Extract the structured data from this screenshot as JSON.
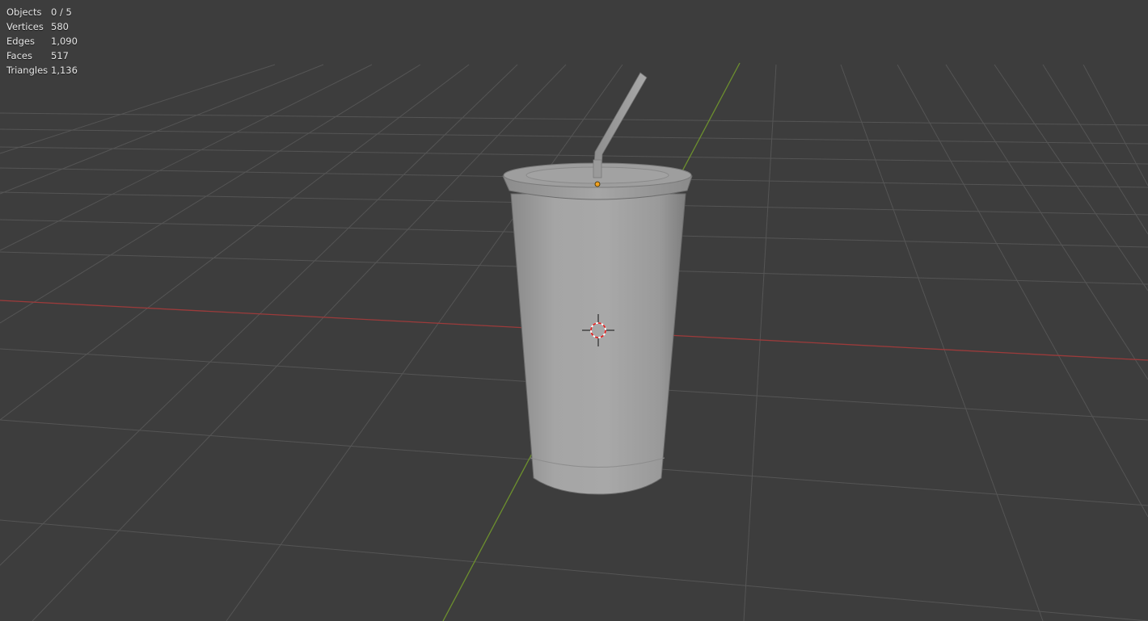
{
  "viewport": {
    "background_color": "#3d3d3d",
    "grid_color": "#555555",
    "x_axis_color": "#9c3b3b",
    "y_axis_color": "#6c8f2e",
    "object_color": "#a3a3a3",
    "object_name_icon": "cup-with-straw-mesh",
    "cursor_icon": "3d-cursor-icon",
    "origin_icon": "object-origin-icon"
  },
  "stats": {
    "objects": {
      "label": "Objects",
      "value": "0 / 5"
    },
    "vertices": {
      "label": "Vertices",
      "value": "580"
    },
    "edges": {
      "label": "Edges",
      "value": "1,090"
    },
    "faces": {
      "label": "Faces",
      "value": "517"
    },
    "triangles": {
      "label": "Triangles",
      "value": "1,136"
    }
  }
}
